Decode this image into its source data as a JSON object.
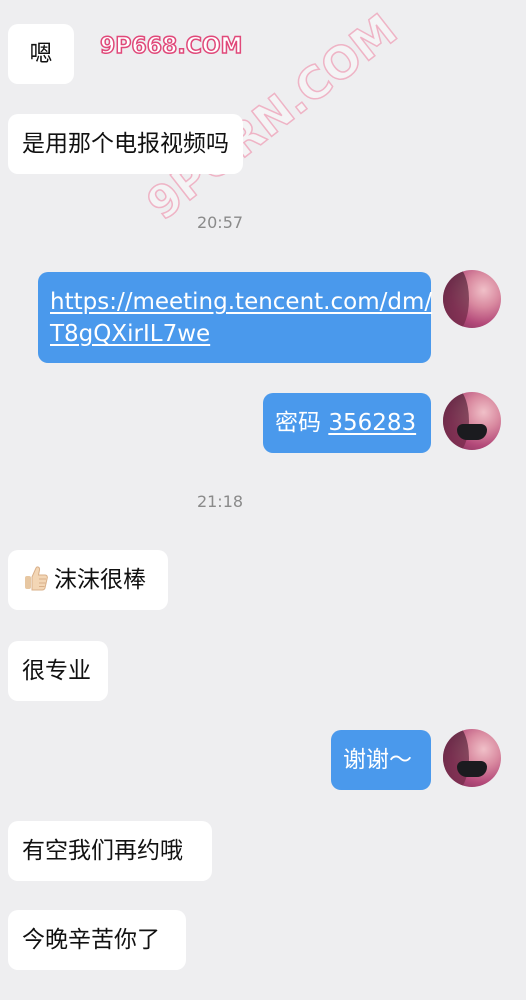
{
  "watermark": "9P668.COM",
  "watermark_diagonal": "9PORN.COM",
  "messages": {
    "m1": "嗯",
    "m2": "是用那个电报视频吗",
    "t1": "20:57",
    "m3_line1": "https://meeting.tencent.com/dm/",
    "m3_line2": "T8gQXirIL7we",
    "m4_prefix": "密码",
    "m4_code": "356283",
    "t2": "21:18",
    "m5": "沫沫很棒",
    "m6": "很专业",
    "m7": "谢谢～",
    "m8": "有空我们再约哦",
    "m9": "今晚辛苦你了"
  },
  "colors": {
    "background": "#eeeef0",
    "incoming_bubble": "#ffffff",
    "outgoing_bubble": "#4a99ec",
    "timestamp": "#8a8a8a"
  },
  "icons": {
    "thumbs_up": "thumbs-up-emoji"
  }
}
